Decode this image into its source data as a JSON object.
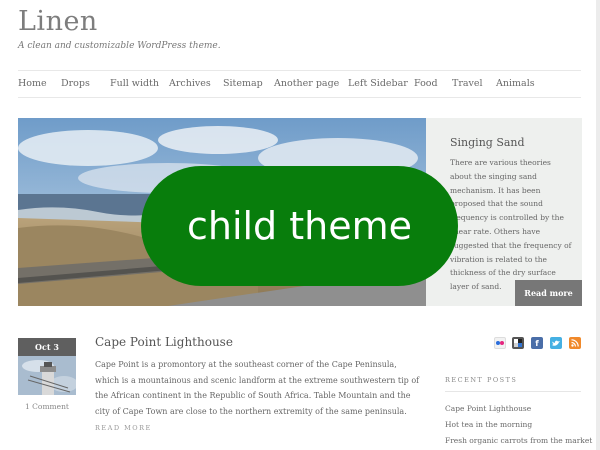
{
  "site": {
    "title": "Linen",
    "description": "A clean and customizable WordPress theme."
  },
  "nav": {
    "items": [
      {
        "label": "Home"
      },
      {
        "label": "Drops"
      },
      {
        "label": "Full width"
      },
      {
        "label": "Archives"
      },
      {
        "label": "Sitemap"
      },
      {
        "label": "Another page"
      },
      {
        "label": "Left Sidebar"
      },
      {
        "label": "Food"
      },
      {
        "label": "Travel"
      },
      {
        "label": "Animals"
      }
    ]
  },
  "featured": {
    "title": "Singing Sand",
    "excerpt": "There are various theories about the singing sand mechanism. It has been proposed that the sound frequency is controlled by the shear rate. Others have suggested that the frequency of vibration is related to the thickness of the dry surface layer of sand.",
    "button_label": "Read more"
  },
  "overlay": {
    "label": "child theme"
  },
  "post": {
    "date": "Oct 3",
    "comments": "1 Comment",
    "title": "Cape Point Lighthouse",
    "excerpt": "Cape Point is a promontory at the southeast corner of the Cape Peninsula, which is a mountainous and scenic landform at the extreme southwestern tip of the African continent in the Republic of South Africa. Table Mountain and the city of Cape Town are close to the northern extremity of the same peninsula.",
    "more_label": "READ MORE"
  },
  "social": {
    "icons": [
      "flickr-icon",
      "delicious-icon",
      "facebook-icon",
      "twitter-icon",
      "rss-icon"
    ]
  },
  "sidebar": {
    "recent_heading": "RECENT POSTS",
    "recent_posts": [
      {
        "label": "Cape Point Lighthouse"
      },
      {
        "label": "Hot tea in the morning"
      },
      {
        "label": "Fresh organic carrots from the market"
      }
    ]
  },
  "colors": {
    "badge": "#087d0c",
    "button": "#777777",
    "panel": "#eef0ee"
  }
}
